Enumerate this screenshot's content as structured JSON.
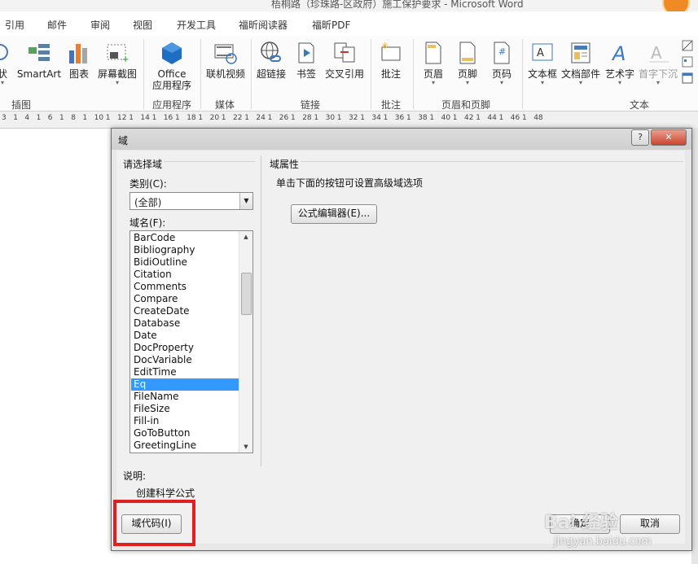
{
  "window": {
    "title": "梧桐路（珍珠路-区政府）施工保护要求 - Microsoft Word"
  },
  "tabs": [
    "引用",
    "邮件",
    "审阅",
    "视图",
    "开发工具",
    "福昕阅读器",
    "福昕PDF"
  ],
  "ribbon": {
    "buttons": {
      "shapes": "状",
      "smartart": "SmartArt",
      "chart": "图表",
      "screenshot": "屏幕截图",
      "office_apps_1": "Office",
      "office_apps_2": "应用程序",
      "online_video": "联机视频",
      "hyperlink": "超链接",
      "bookmark": "书签",
      "cross_ref": "交叉引用",
      "comment": "批注",
      "header": "页眉",
      "footer": "页脚",
      "page_number": "页码",
      "textbox": "文本框",
      "quick_parts": "文档部件",
      "wordart": "艺术字",
      "drop_cap": "首字下沉"
    },
    "groups": {
      "illustrations": "插图",
      "apps": "应用程序",
      "media": "媒体",
      "links": "链接",
      "comments": "批注",
      "header_footer": "页眉和页脚",
      "text": "文本"
    }
  },
  "ruler": {
    "ticks": [
      "3",
      "1",
      "4",
      "1",
      "6",
      "1",
      "8",
      "1",
      "10",
      "1",
      "12",
      "1",
      "14",
      "1",
      "16",
      "1",
      "18",
      "1",
      "20",
      "1",
      "22",
      "1",
      "24",
      "1",
      "26",
      "1",
      "28",
      "1",
      "30",
      "1",
      "32",
      "1",
      "34",
      "1",
      "36",
      "1",
      "38",
      "1",
      "40",
      "1",
      "42",
      "1",
      "44",
      "1",
      "46",
      "1",
      "48"
    ]
  },
  "dialog": {
    "title": "域",
    "help": "?",
    "close": "✕",
    "choose_field": "请选择域",
    "category_label": "类别(C):",
    "category_value": "(全部)",
    "field_names_label": "域名(F):",
    "field_names": [
      "BarCode",
      "Bibliography",
      "BidiOutline",
      "Citation",
      "Comments",
      "Compare",
      "CreateDate",
      "Database",
      "Date",
      "DocProperty",
      "DocVariable",
      "EditTime",
      "Eq",
      "FileName",
      "FileSize",
      "Fill-in",
      "GoToButton",
      "GreetingLine"
    ],
    "selected_field": "Eq",
    "field_properties": "域属性",
    "advanced_hint": "单击下面的按钮可设置高级域选项",
    "formula_editor_button": "公式编辑器(E)...",
    "description_label": "说明:",
    "description_text": "创建科学公式",
    "field_codes_button": "域代码(I)",
    "ok_button": "确定",
    "cancel_button": "取消"
  },
  "watermark": {
    "brand": "Bai 经验",
    "url": "jingyan.baidu.com"
  },
  "colors": {
    "selection": "#3399ff",
    "highlight": "#e02020",
    "close_button": "#c9432d"
  }
}
